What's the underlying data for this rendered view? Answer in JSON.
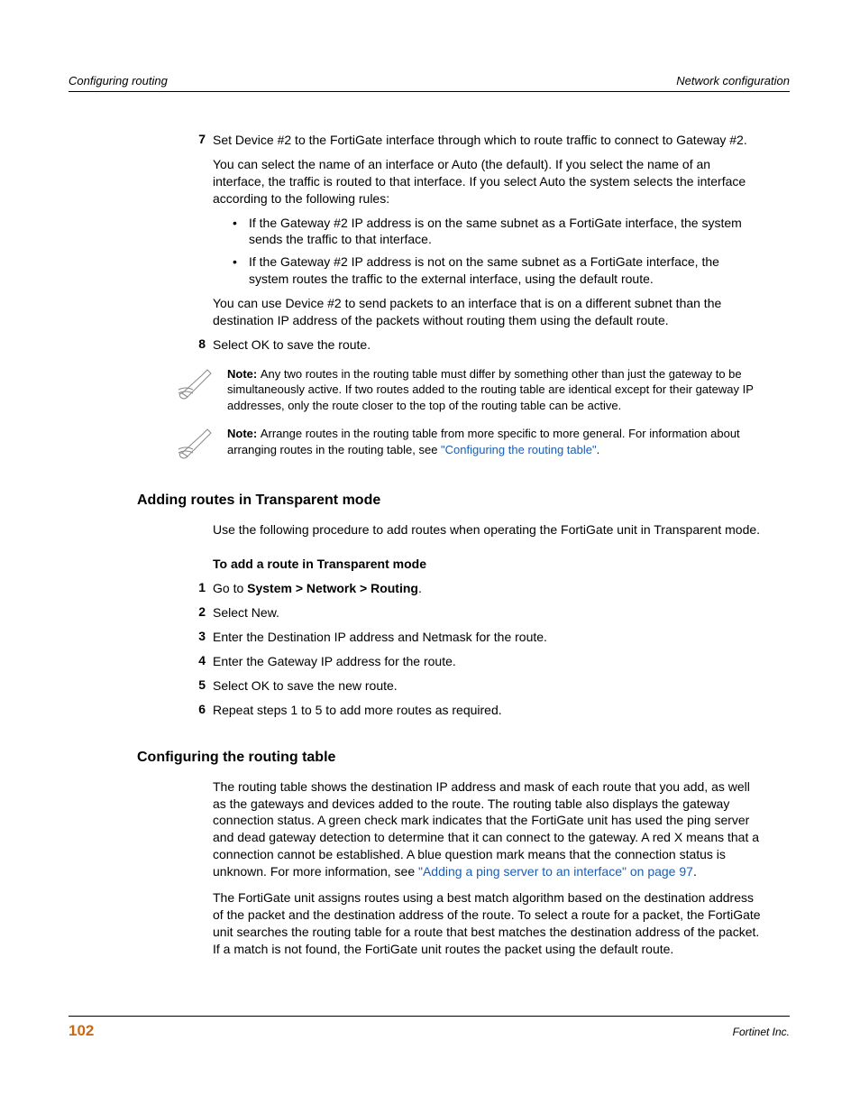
{
  "header": {
    "left": "Configuring routing",
    "right": "Network configuration"
  },
  "step7": {
    "num": "7",
    "p1": "Set Device #2 to the FortiGate interface through which to route traffic to connect to Gateway #2.",
    "p2": "You can select the name of an interface or Auto (the default). If you select the name of an interface, the traffic is routed to that interface. If you select Auto the system selects the interface according to the following rules:",
    "b1": "If the Gateway #2 IP address is on the same subnet as a FortiGate interface, the system sends the traffic to that interface.",
    "b2": "If the Gateway #2 IP address is not on the same subnet as a FortiGate interface, the system routes the traffic to the external interface, using the default route.",
    "p3": "You can use Device #2 to send packets to an interface that is on a different subnet than the destination IP address of the packets without routing them using the default route."
  },
  "step8": {
    "num": "8",
    "p1": "Select OK to save the route."
  },
  "note1": {
    "label": "Note: ",
    "text": "Any two routes in the routing table must differ by something other than just the gateway to be simultaneously active. If two routes added to the routing table are identical except for their gateway IP addresses, only the route closer to the top of the routing table can be active."
  },
  "note2": {
    "label": "Note: ",
    "text_before": "Arrange routes in the routing table from more specific to more general. For information about arranging routes in the routing table, see ",
    "link": "\"Configuring the routing table\"",
    "text_after": "."
  },
  "section1": {
    "title": "Adding routes in Transparent mode",
    "intro": "Use the following procedure to add routes when operating the FortiGate unit in Transparent mode.",
    "subhead": "To add a route in Transparent mode",
    "steps": [
      {
        "num": "1",
        "pre": "Go to ",
        "bold": "System > Network > Routing",
        "post": "."
      },
      {
        "num": "2",
        "text": "Select New."
      },
      {
        "num": "3",
        "text": "Enter the Destination IP address and Netmask for the route."
      },
      {
        "num": "4",
        "text": "Enter the Gateway IP address for the route."
      },
      {
        "num": "5",
        "text": "Select OK to save the new route."
      },
      {
        "num": "6",
        "text": "Repeat steps 1 to 5 to add more routes as required."
      }
    ]
  },
  "section2": {
    "title": "Configuring the routing table",
    "p1_before": "The routing table shows the destination IP address and mask of each route that you add, as well as the gateways and devices added to the route. The routing table also displays the gateway connection status. A green check mark indicates that the FortiGate unit has used the ping server and dead gateway detection to determine that it can connect to the gateway. A red X means that a connection cannot be established. A blue question mark means that the connection status is unknown. For more information, see ",
    "p1_link": "\"Adding a ping server to an interface\" on page 97",
    "p1_after": ".",
    "p2": "The FortiGate unit assigns routes using a best match algorithm based on the destination address of the packet and the destination address of the route. To select a route for a packet, the FortiGate unit searches the routing table for a route that best matches the destination address of the packet. If a match is not found, the FortiGate unit routes the packet using the default route."
  },
  "footer": {
    "page": "102",
    "right": "Fortinet Inc."
  }
}
